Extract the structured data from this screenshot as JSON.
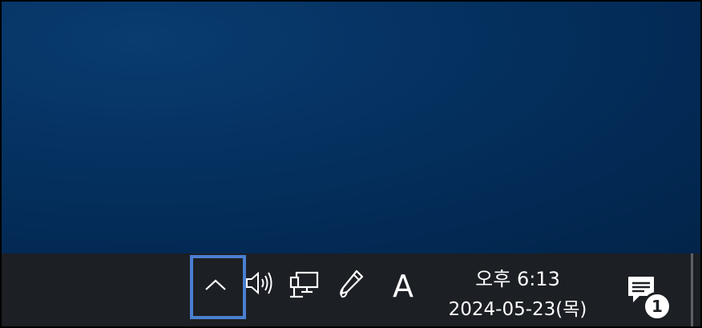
{
  "tray": {
    "chevron_icon": "chevron-up-icon",
    "volume_icon": "speaker-icon",
    "network_icon": "ethernet-network-icon",
    "pen_icon": "pen-workspace-icon",
    "ime_label": "A"
  },
  "clock": {
    "time": "오후 6:13",
    "date": "2024-05-23(목)"
  },
  "notifications": {
    "icon": "action-center-icon",
    "count": "1"
  },
  "colors": {
    "desktop": "#053262",
    "taskbar": "#1c1f24",
    "highlight": "#4a7fd1",
    "icon": "#ffffff"
  }
}
